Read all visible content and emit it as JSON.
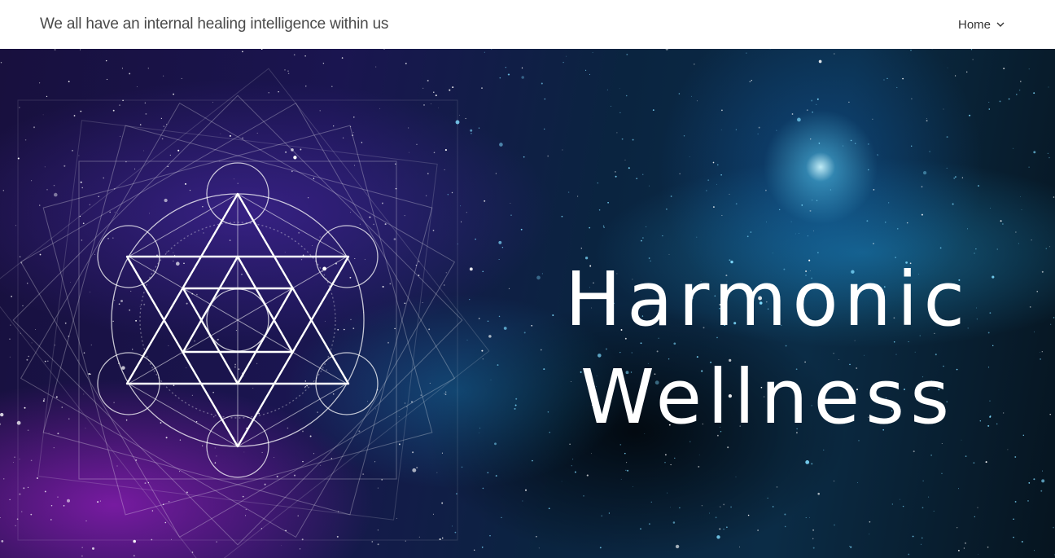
{
  "header": {
    "tagline": "We all have an internal healing intelligence within us",
    "nav": {
      "label": "Home",
      "icon": "chevron-down-icon"
    }
  },
  "hero": {
    "title_line1": "Harmonic",
    "title_line2": "Wellness",
    "background": "starfield-nebula",
    "emblem": "sacred-geometry-metatron-cube",
    "colors": {
      "space_dark": "#06141f",
      "nebula_purple": "#7a1fa8",
      "star_blue": "#50c8ff",
      "line_white": "#ffffff"
    }
  }
}
